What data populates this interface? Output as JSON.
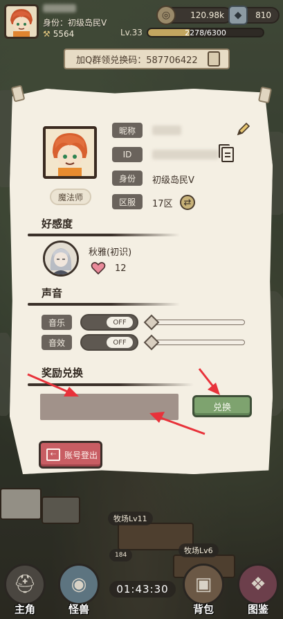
{
  "hud": {
    "title_line": "身份：初级岛民Ⅴ",
    "power": "5564",
    "gold": "120.98k",
    "gems": "810",
    "level": "Lv.33",
    "xp_text": "2278/6300",
    "xp_progress": 0.3616,
    "redeem_banner": "加Q群领兑换码：587706422"
  },
  "profile": {
    "nickname_label": "昵称",
    "id_label": "ID",
    "rank_label": "身份",
    "rank_value": "初级岛民Ⅴ",
    "server_label": "区服",
    "server_value": "17区",
    "class_name": "魔法师"
  },
  "affinity": {
    "title": "好感度",
    "npc_name": "秋雅(初识)",
    "hearts": "12"
  },
  "sound": {
    "title": "声音",
    "music_label": "音乐",
    "music_state": "OFF",
    "sfx_label": "音效",
    "sfx_state": "OFF",
    "music_volume": 0,
    "sfx_volume": 0
  },
  "redeem": {
    "title": "奖励兑换",
    "input_value": "",
    "button_label": "兑换"
  },
  "logout": {
    "label": "账号登出"
  },
  "scene": {
    "ranch1": "牧场Lv11",
    "ranch2": "牧场Lv6",
    "timer": "01:43:30",
    "bubble": "184"
  },
  "nav": {
    "items": [
      "主角",
      "怪兽",
      "背包",
      "图鉴"
    ]
  },
  "colors": {
    "panel_bg": "#f4efe3",
    "label_bg": "#6a635c",
    "redeem_btn": "#7ea36f",
    "logout_btn": "#c85d63",
    "annotation_arrow": "#e8323a"
  }
}
